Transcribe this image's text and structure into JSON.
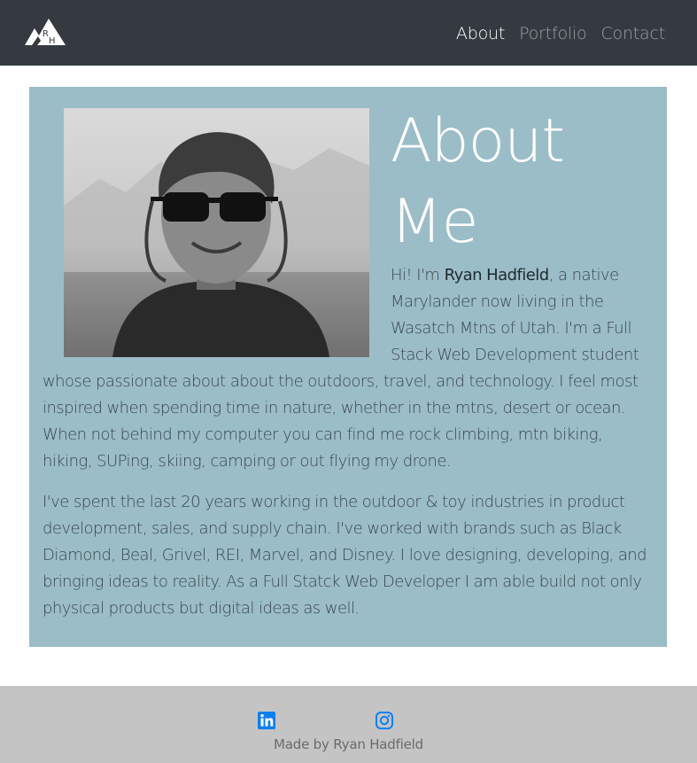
{
  "navbar": {
    "logo_letters": "RH",
    "links": [
      {
        "label": "About",
        "active": true
      },
      {
        "label": "Portfolio",
        "active": false
      },
      {
        "label": "Contact",
        "active": false
      }
    ]
  },
  "about": {
    "title_line1": "About",
    "title_line2": "Me",
    "p1_intro": "Hi! I'm ",
    "p1_name": "Ryan Hadfield",
    "p1_rest": ", a native Marylander now living in the Wasatch Mtns of Utah. I'm a Full Stack Web Development student whose passionate about about the outdoors, travel, and technology. I feel most inspired when spending time in nature, whether in the mtns, desert or ocean. When not behind my computer you can find me rock climbing, mtn biking, hiking, SUPing, skiing, camping or out flying my drone.",
    "p2": "I've spent the last 20 years working in the outdoor & toy industries in product development, sales, and supply chain. I've worked with brands such as Black Diamond, Beal, Grivel, REI, Marvel, and Disney. I love designing, developing, and bringing ideas to reality. As a Full Statck Web Developer I am able build not only physical products but digital ideas as well."
  },
  "footer": {
    "social": [
      "linkedin-icon",
      "instagram-icon"
    ],
    "credit": "Made by Ryan Hadfield"
  },
  "colors": {
    "navbar_bg": "#343a40",
    "card_bg": "#9bbdc8",
    "footer_bg": "#c4c4c4",
    "icon_blue": "#0d7ff2"
  }
}
